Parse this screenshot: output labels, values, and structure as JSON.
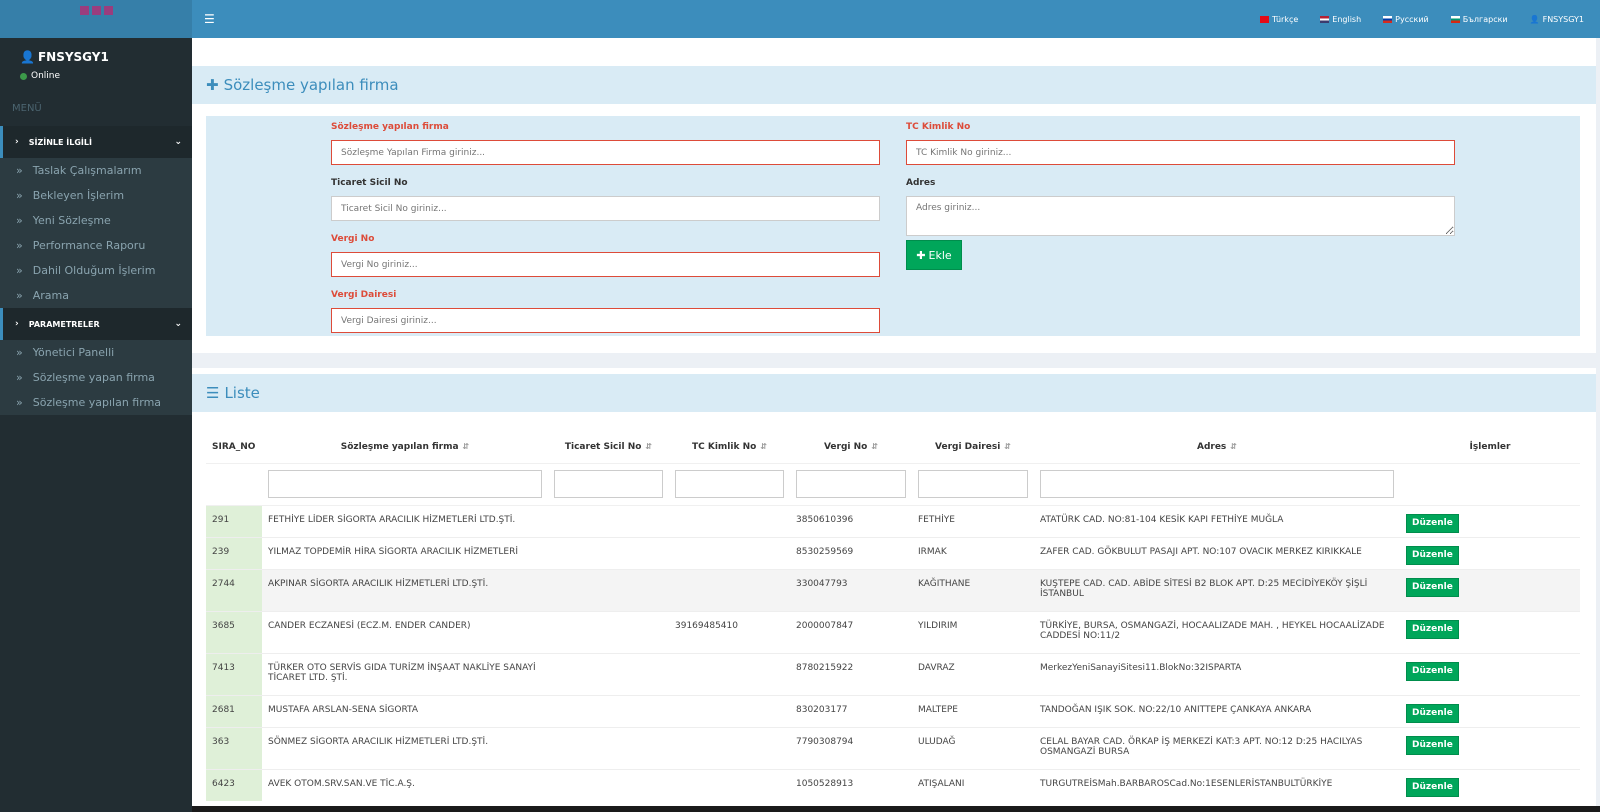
{
  "sidebar": {
    "user_name": "FNSYSGY1",
    "status": "Online",
    "menu_header": "MENÜ",
    "groups": [
      {
        "label": "SİZİNLE İLGİLİ",
        "items": [
          "Taslak Çalışmalarım",
          "Bekleyen İşlerim",
          "Yeni Sözleşme",
          "Performance Raporu",
          "Dahil Olduğum İşlerim",
          "Arama"
        ]
      },
      {
        "label": "PARAMETRELER",
        "items": [
          "Yönetici Panelli",
          "Sözleşme yapan firma",
          "Sözleşme yapılan firma"
        ]
      }
    ]
  },
  "topbar": {
    "languages": [
      "Türkçe",
      "English",
      "Русский",
      "Български"
    ],
    "user": "FNSYSGY1"
  },
  "form": {
    "title": "Sözleşme yapılan firma",
    "firma_label": "Sözleşme yapılan firma",
    "firma_placeholder": "Sözleşme Yapılan Firma giriniz...",
    "tc_label": "TC Kimlik No",
    "tc_placeholder": "TC Kimlik No giriniz...",
    "ticaret_label": "Ticaret Sicil No",
    "ticaret_placeholder": "Ticaret Sicil No giriniz...",
    "adres_label": "Adres",
    "adres_placeholder": "Adres giriniz...",
    "vergi_label": "Vergi No",
    "vergi_placeholder": "Vergi No giriniz...",
    "daire_label": "Vergi Dairesi",
    "daire_placeholder": "Vergi Dairesi giriniz...",
    "add_button": "Ekle"
  },
  "list": {
    "title": "Liste",
    "columns": [
      "SIRA_NO",
      "Sözleşme yapılan firma",
      "Ticaret Sicil No",
      "TC Kimlik No",
      "Vergi No",
      "Vergi Dairesi",
      "Adres",
      "İşlemler"
    ],
    "edit_label": "Düzenle",
    "rows": [
      {
        "sira": "291",
        "firma": "FETHİYE LİDER SİGORTA ARACILIK HİZMETLERİ LTD.ŞTİ.",
        "ticaret": "",
        "tc": "",
        "vergi": "3850610396",
        "daire": "FETHİYE",
        "adres": "ATATÜRK CAD. NO:81-104 KESİK KAPI FETHİYE MUĞLA"
      },
      {
        "sira": "239",
        "firma": "YILMAZ TOPDEMİR HİRA SİGORTA ARACILIK HİZMETLERİ",
        "ticaret": "",
        "tc": "",
        "vergi": "8530259569",
        "daire": "IRMAK",
        "adres": "ZAFER CAD. GÖKBULUT PASAJI APT. NO:107 OVACIK MERKEZ KIRIKKALE"
      },
      {
        "sira": "2744",
        "firma": "AKPINAR SİGORTA ARACILIK HİZMETLERİ LTD.ŞTİ.",
        "ticaret": "",
        "tc": "",
        "vergi": "330047793",
        "daire": "KAĞITHANE",
        "adres": "KUŞTEPE CAD. CAD. ABİDE SİTESİ B2 BLOK APT. D:25 MECİDİYEKÖY ŞİŞLİ İSTANBUL"
      },
      {
        "sira": "3685",
        "firma": "CANDER ECZANESİ (ECZ.M. ENDER CANDER)",
        "ticaret": "",
        "tc": "39169485410",
        "vergi": "2000007847",
        "daire": "YILDIRIM",
        "adres": "TÜRKİYE, BURSA, OSMANGAZİ, HOCAALIZADE MAH. , HEYKEL HOCAALİZADE CADDESİ NO:11/2"
      },
      {
        "sira": "7413",
        "firma": "TÜRKER OTO SERVİS GIDA TURİZM İNŞAAT NAKLİYE SANAYİ TİCARET LTD. ŞTİ.",
        "ticaret": "",
        "tc": "",
        "vergi": "8780215922",
        "daire": "DAVRAZ",
        "adres": "MerkezYeniSanayiSitesi11.BlokNo:32ISPARTA"
      },
      {
        "sira": "2681",
        "firma": "MUSTAFA ARSLAN-SENA SİGORTA",
        "ticaret": "",
        "tc": "",
        "vergi": "830203177",
        "daire": "MALTEPE",
        "adres": "TANDOĞAN IŞIK SOK. NO:22/10 ANITTEPE ÇANKAYA ANKARA"
      },
      {
        "sira": "363",
        "firma": "SÖNMEZ SİGORTA ARACILIK HİZMETLERİ LTD.ŞTİ.",
        "ticaret": "",
        "tc": "",
        "vergi": "7790308794",
        "daire": "ULUDAĞ",
        "adres": "CELAL BAYAR CAD. ÖRKAP İŞ MERKEZİ KAT:3 APT. NO:12 D:25 HACILYAS OSMANGAZİ BURSA"
      },
      {
        "sira": "6423",
        "firma": "AVEK OTOM.SRV.SAN.VE TİC.A.Ş.",
        "ticaret": "",
        "tc": "",
        "vergi": "1050528913",
        "daire": "ATIŞALANI",
        "adres": "TURGUTREİSMah.BARBAROSCad.No:1ESENLERİSTANBULTÜRKİYE"
      }
    ]
  },
  "colors": {
    "topbar": "#3c8dbc",
    "sidebar": "#222d32",
    "required": "#dd4b39",
    "success": "#00a65a"
  }
}
